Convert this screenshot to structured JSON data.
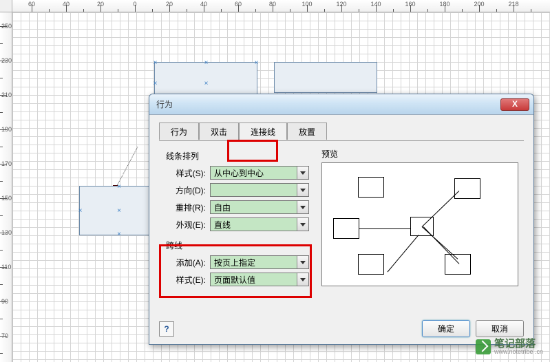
{
  "ruler_h": [
    -60,
    -40,
    -20,
    0,
    20,
    40,
    60,
    80,
    100,
    120,
    140,
    160,
    180,
    200,
    218
  ],
  "ruler_v": [
    250,
    230,
    210,
    190,
    170,
    150,
    130,
    110,
    90,
    70
  ],
  "dialog": {
    "title": "行为",
    "tabs": [
      "行为",
      "双击",
      "连接线",
      "放置"
    ],
    "active_tab": 2,
    "section1_title": "线条排列",
    "section2_title": "跨线",
    "fields": {
      "style1": {
        "label": "样式(S):",
        "value": "从中心到中心"
      },
      "direction": {
        "label": "方向(D):",
        "value": ""
      },
      "reroute": {
        "label": "重排(R):",
        "value": "自由"
      },
      "appearance": {
        "label": "外观(E):",
        "value": "直线"
      },
      "add": {
        "label": "添加(A):",
        "value": "按页上指定"
      },
      "style2": {
        "label": "样式(E):",
        "value": "页面默认值"
      }
    },
    "preview_title": "预览",
    "help": "?",
    "ok": "确定",
    "cancel": "取消"
  },
  "watermark": {
    "line1": "笔记部落",
    "line2": "www.notetribe .cn"
  }
}
